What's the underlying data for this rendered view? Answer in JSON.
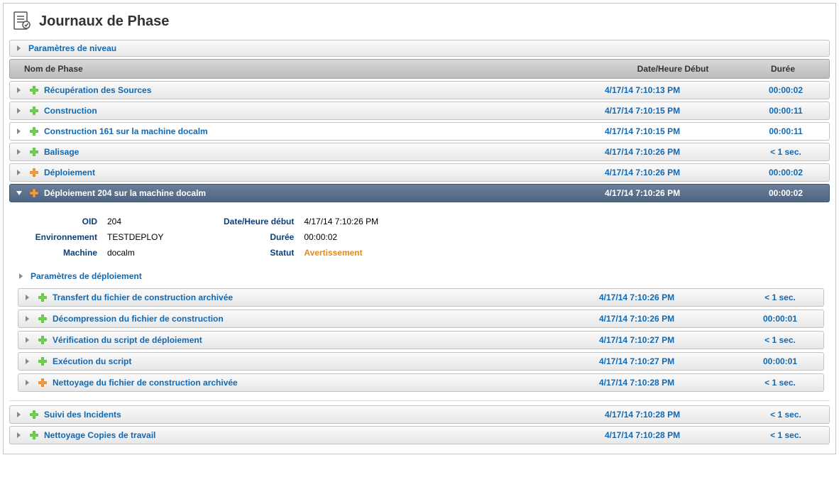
{
  "page_title": "Journaux de Phase",
  "level_params_label": "Paramètres de niveau",
  "columns": {
    "name": "Nom de Phase",
    "date": "Date/Heure Début",
    "dur": "Durée"
  },
  "phases": [
    {
      "status": "ok",
      "label": "Récupération des Sources",
      "date": "4/17/14 7:10:13 PM",
      "dur": "00:00:02"
    },
    {
      "status": "ok",
      "label": "Construction",
      "date": "4/17/14 7:10:15 PM",
      "dur": "00:00:11"
    },
    {
      "status": "ok",
      "label": "Construction 161 sur la machine docalm",
      "date": "4/17/14 7:10:15 PM",
      "dur": "00:00:11",
      "plain": true
    },
    {
      "status": "ok",
      "label": "Balisage",
      "date": "4/17/14 7:10:26 PM",
      "dur": "< 1 sec."
    },
    {
      "status": "warn",
      "label": "Déploiement",
      "date": "4/17/14 7:10:26 PM",
      "dur": "00:00:02"
    }
  ],
  "active_phase": {
    "label": "Déploiement 204 sur la machine docalm",
    "date": "4/17/14 7:10:26 PM",
    "dur": "00:00:02",
    "details": {
      "oid_label": "OID",
      "oid": "204",
      "env_label": "Environnement",
      "env": "TESTDEPLOY",
      "machine_label": "Machine",
      "machine": "docalm",
      "start_label": "Date/Heure début",
      "start": "4/17/14 7:10:26 PM",
      "dur_label": "Durée",
      "dur": "00:00:02",
      "status_label": "Statut",
      "status": "Avertissement"
    },
    "deploy_params_label": "Paramètres de déploiement",
    "steps": [
      {
        "status": "ok",
        "label": "Transfert du fichier de construction archivée",
        "date": "4/17/14 7:10:26 PM",
        "dur": "< 1 sec."
      },
      {
        "status": "ok",
        "label": "Décompression du fichier de construction",
        "date": "4/17/14 7:10:26 PM",
        "dur": "00:00:01"
      },
      {
        "status": "ok",
        "label": "Vérification du script de déploiement",
        "date": "4/17/14 7:10:27 PM",
        "dur": "< 1 sec."
      },
      {
        "status": "ok",
        "label": "Exécution du script",
        "date": "4/17/14 7:10:27 PM",
        "dur": "00:00:01"
      },
      {
        "status": "warn",
        "label": "Nettoyage du fichier de construction archivée",
        "date": "4/17/14 7:10:28 PM",
        "dur": "< 1 sec."
      }
    ]
  },
  "tail_phases": [
    {
      "status": "ok",
      "label": "Suivi des Incidents",
      "date": "4/17/14 7:10:28 PM",
      "dur": "< 1 sec."
    },
    {
      "status": "ok",
      "label": "Nettoyage Copies de travail",
      "date": "4/17/14 7:10:28 PM",
      "dur": "< 1 sec."
    }
  ]
}
